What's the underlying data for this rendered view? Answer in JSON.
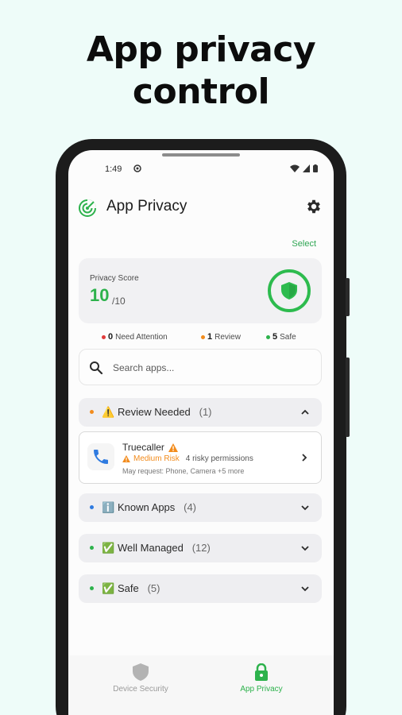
{
  "headline": {
    "line1": "App privacy",
    "line2": "control"
  },
  "status_bar": {
    "time": "1:49"
  },
  "app_bar": {
    "title": "App Privacy",
    "settings_icon": "gear-icon",
    "logo_icon": "radar-icon"
  },
  "select_label": "Select",
  "privacy_score": {
    "label": "Privacy Score",
    "value": "10",
    "max": "/10",
    "icon": "shield-icon"
  },
  "summary": {
    "attention": {
      "count": "0",
      "label": "Need Attention",
      "color": "#e03a3a"
    },
    "review": {
      "count": "1",
      "label": "Review",
      "color": "#f28b1c"
    },
    "safe": {
      "count": "5",
      "label": "Safe",
      "color": "#2db24c"
    }
  },
  "search": {
    "placeholder": "Search apps..."
  },
  "sections": [
    {
      "emoji": "⚠️",
      "title": "Review Needed",
      "count": "(1)",
      "color": "#f28b1c",
      "expanded": true
    },
    {
      "emoji": "ℹ️",
      "title": "Known Apps",
      "count": "(4)",
      "color": "#2f7be0",
      "expanded": false
    },
    {
      "emoji": "✅",
      "title": "Well Managed",
      "count": "(12)",
      "color": "#2db24c",
      "expanded": false
    },
    {
      "emoji": "✅",
      "title": "Safe",
      "count": "(5)",
      "color": "#2db24c",
      "expanded": false
    }
  ],
  "review_app": {
    "name": "Truecaller",
    "risk_level": "Medium Risk",
    "risky_permissions": "4 risky permissions",
    "may_request": "May request: Phone, Camera +5 more",
    "icon": "phone-icon"
  },
  "bottom_nav": [
    {
      "label": "Device Security",
      "icon": "shield-icon",
      "active": false
    },
    {
      "label": "App Privacy",
      "icon": "lock-icon",
      "active": true
    }
  ],
  "colors": {
    "accent": "#2db24c",
    "warning": "#f28b1c",
    "info": "#2f7be0",
    "danger": "#e03a3a"
  }
}
